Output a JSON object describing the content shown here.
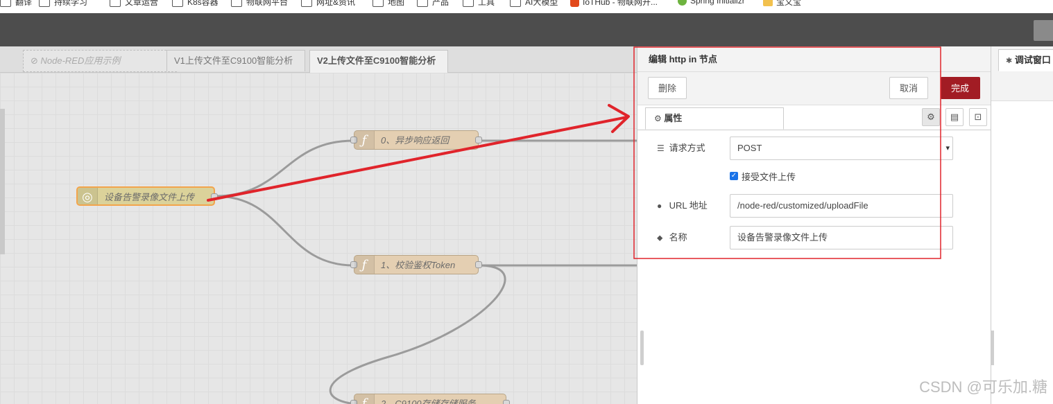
{
  "bookmarks": [
    {
      "label": "翻译",
      "icon": "folder-icon"
    },
    {
      "label": "持续学习",
      "icon": "folder-icon"
    },
    {
      "label": "文章运营",
      "icon": "folder-icon"
    },
    {
      "label": "K8s容器",
      "icon": "folder-icon"
    },
    {
      "label": "物联网平台",
      "icon": "folder-icon"
    },
    {
      "label": "网址&资讯",
      "icon": "folder-icon"
    },
    {
      "label": "地图",
      "icon": "folder-icon"
    },
    {
      "label": "产品",
      "icon": "folder-icon"
    },
    {
      "label": "工具",
      "icon": "folder-icon"
    },
    {
      "label": "AI大模型",
      "icon": "folder-icon"
    },
    {
      "label": "IoTHub - 物联网开...",
      "icon": "iothub-icon"
    },
    {
      "label": "Spring Initializr",
      "icon": "spring-icon"
    },
    {
      "label": "宝义宝",
      "icon": "folder-icon"
    }
  ],
  "workspace": {
    "tabs": [
      {
        "label": "⊘ Node-RED应用示例",
        "state": "disabled"
      },
      {
        "label": "V1上传文件至C9100智能分析",
        "state": "normal"
      },
      {
        "label": "V2上传文件至C9100智能分析",
        "state": "active"
      }
    ],
    "nodes": {
      "http_in": {
        "label": "设备告警录像文件上传",
        "icon": "globe-icon"
      },
      "func0": {
        "label": "0、异步响应返回",
        "icon": "function-icon"
      },
      "func1": {
        "label": "1、校验鉴权Token",
        "icon": "function-icon"
      },
      "func2": {
        "label": "2、C9100存储存储服务",
        "icon": "function-icon"
      }
    }
  },
  "tray": {
    "title": "编辑 http in 节点",
    "delete_label": "删除",
    "cancel_label": "取消",
    "done_label": "完成",
    "tab_properties": "属性",
    "fields": {
      "method_label": "请求方式",
      "method_value": "POST",
      "upload_label": "接受文件上传",
      "upload_checked": true,
      "url_label": "URL 地址",
      "url_value": "/node-red/customized/uploadFile",
      "name_label": "名称",
      "name_value": "设备告警录像文件上传"
    }
  },
  "sidebar": {
    "tab_label": "调试窗口"
  },
  "watermark": "CSDN @可乐加.糖",
  "colors": {
    "header": "#4d4d4d",
    "done_button": "#a21c24",
    "annotation_red": "#e0242b",
    "function_node": "#e4cfb2",
    "http_node": "#dbd29a"
  }
}
